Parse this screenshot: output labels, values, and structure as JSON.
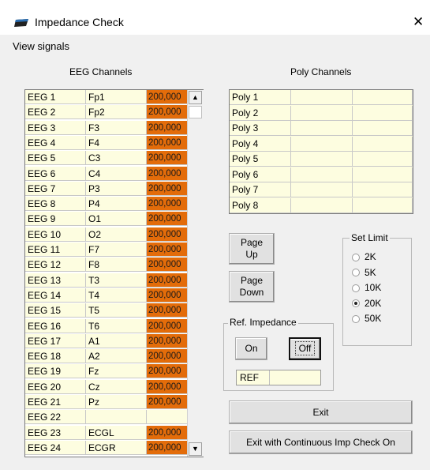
{
  "window": {
    "title": "Impedance Check",
    "close_glyph": "✕",
    "icon": "app-icon"
  },
  "menu": {
    "view_signals": "View signals"
  },
  "eeg": {
    "label": "EEG Channels",
    "rows": [
      {
        "name": "EEG 1",
        "site": "Fp1",
        "value": "200,000"
      },
      {
        "name": "EEG 2",
        "site": "Fp2",
        "value": "200,000"
      },
      {
        "name": "EEG 3",
        "site": "F3",
        "value": "200,000"
      },
      {
        "name": "EEG 4",
        "site": "F4",
        "value": "200,000"
      },
      {
        "name": "EEG 5",
        "site": "C3",
        "value": "200,000"
      },
      {
        "name": "EEG 6",
        "site": "C4",
        "value": "200,000"
      },
      {
        "name": "EEG 7",
        "site": "P3",
        "value": "200,000"
      },
      {
        "name": "EEG 8",
        "site": "P4",
        "value": "200,000"
      },
      {
        "name": "EEG 9",
        "site": "O1",
        "value": "200,000"
      },
      {
        "name": "EEG 10",
        "site": "O2",
        "value": "200,000"
      },
      {
        "name": "EEG 11",
        "site": "F7",
        "value": "200,000"
      },
      {
        "name": "EEG 12",
        "site": "F8",
        "value": "200,000"
      },
      {
        "name": "EEG 13",
        "site": "T3",
        "value": "200,000"
      },
      {
        "name": "EEG 14",
        "site": "T4",
        "value": "200,000"
      },
      {
        "name": "EEG 15",
        "site": "T5",
        "value": "200,000"
      },
      {
        "name": "EEG 16",
        "site": "T6",
        "value": "200,000"
      },
      {
        "name": "EEG 17",
        "site": "A1",
        "value": "200,000"
      },
      {
        "name": "EEG 18",
        "site": "A2",
        "value": "200,000"
      },
      {
        "name": "EEG 19",
        "site": "Fz",
        "value": "200,000"
      },
      {
        "name": "EEG 20",
        "site": "Cz",
        "value": "200,000"
      },
      {
        "name": "EEG 21",
        "site": "Pz",
        "value": "200,000"
      },
      {
        "name": "EEG 22",
        "site": "",
        "value": ""
      },
      {
        "name": "EEG 23",
        "site": "ECGL",
        "value": "200,000"
      },
      {
        "name": "EEG 24",
        "site": "ECGR",
        "value": "200,000"
      }
    ],
    "value_color": "#e36c0a",
    "cell_color": "#fdfde0"
  },
  "poly": {
    "label": "Poly Channels",
    "rows": [
      "Poly 1",
      "Poly 2",
      "Poly 3",
      "Poly 4",
      "Poly 5",
      "Poly 6",
      "Poly 7",
      "Poly 8"
    ]
  },
  "buttons": {
    "page_up_1": "Page",
    "page_up_2": "Up",
    "page_down_1": "Page",
    "page_down_2": "Down",
    "on": "On",
    "off": "Off",
    "exit": "Exit",
    "exit_continuous": "Exit with Continuous Imp Check On"
  },
  "ref": {
    "group_label": "Ref. Impedance",
    "field_label": "REF"
  },
  "limit": {
    "group_label": "Set Limit",
    "options": [
      {
        "label": "2K",
        "selected": false
      },
      {
        "label": "5K",
        "selected": false
      },
      {
        "label": "10K",
        "selected": false
      },
      {
        "label": "20K",
        "selected": true
      },
      {
        "label": "50K",
        "selected": false
      }
    ]
  }
}
